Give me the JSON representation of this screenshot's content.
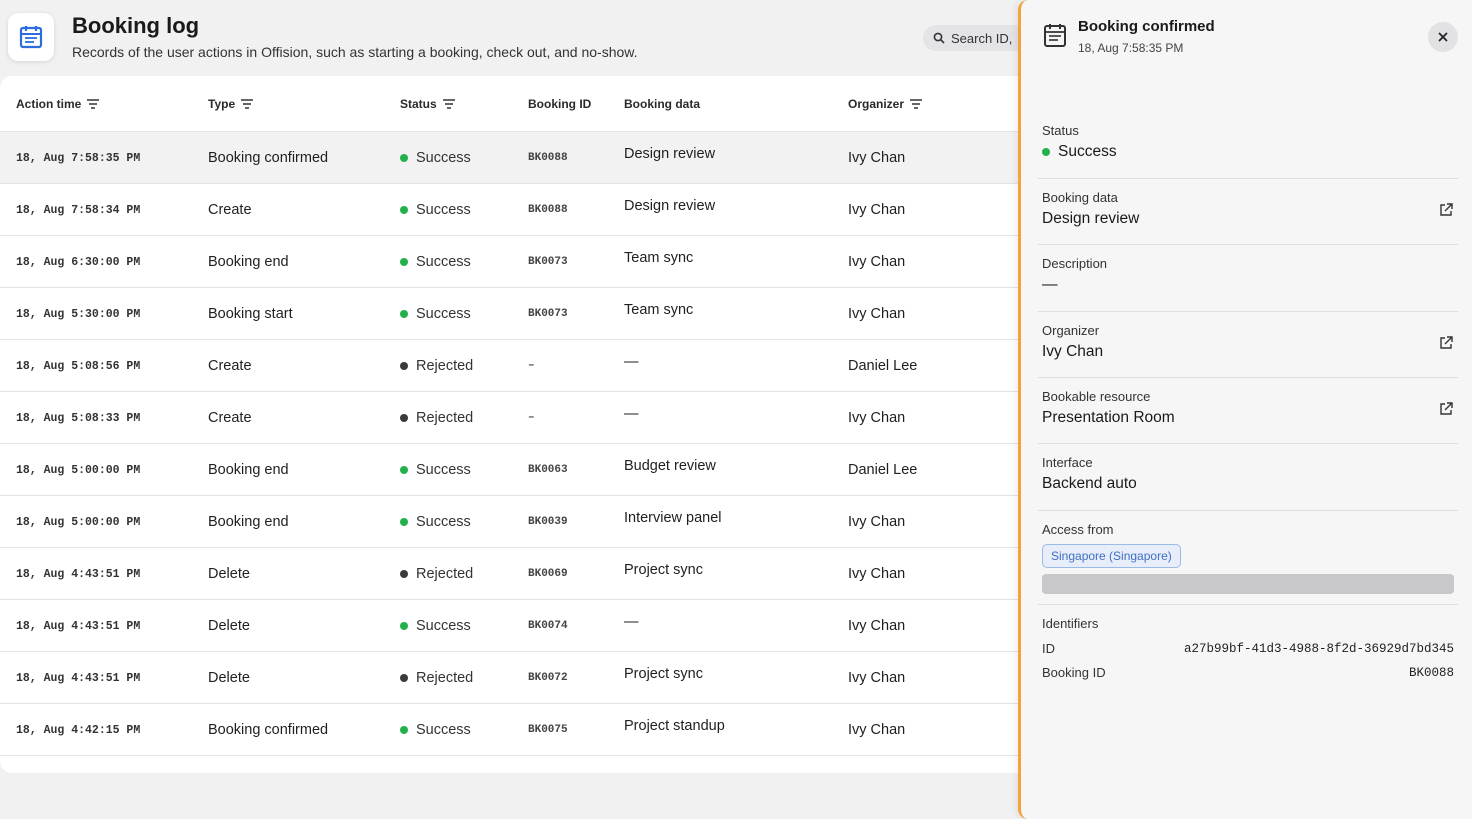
{
  "header": {
    "title": "Booking log",
    "subtitle": "Records of the user actions in Offision, such as starting a booking, check out, and no-show.",
    "search_placeholder": "Search ID,"
  },
  "table": {
    "columns": {
      "action_time": "Action time",
      "type": "Type",
      "status": "Status",
      "booking_id": "Booking ID",
      "booking_data": "Booking data",
      "organizer": "Organizer"
    },
    "rows": [
      {
        "time": "18, Aug 7:58:35 PM",
        "type": "Booking confirmed",
        "status": "Success",
        "booking_id": "BK0088",
        "booking_data": "Design review",
        "organizer": "Ivy Chan"
      },
      {
        "time": "18, Aug 7:58:34 PM",
        "type": "Create",
        "status": "Success",
        "booking_id": "BK0088",
        "booking_data": "Design review",
        "organizer": "Ivy Chan"
      },
      {
        "time": "18, Aug 6:30:00 PM",
        "type": "Booking end",
        "status": "Success",
        "booking_id": "BK0073",
        "booking_data": "Team sync",
        "organizer": "Ivy Chan"
      },
      {
        "time": "18, Aug 5:30:00 PM",
        "type": "Booking start",
        "status": "Success",
        "booking_id": "BK0073",
        "booking_data": "Team sync",
        "organizer": "Ivy Chan"
      },
      {
        "time": "18, Aug 5:08:56 PM",
        "type": "Create",
        "status": "Rejected",
        "booking_id": "–",
        "booking_data": "—",
        "organizer": "Daniel Lee"
      },
      {
        "time": "18, Aug 5:08:33 PM",
        "type": "Create",
        "status": "Rejected",
        "booking_id": "–",
        "booking_data": "—",
        "organizer": "Ivy Chan"
      },
      {
        "time": "18, Aug 5:00:00 PM",
        "type": "Booking end",
        "status": "Success",
        "booking_id": "BK0063",
        "booking_data": "Budget review",
        "organizer": "Daniel Lee"
      },
      {
        "time": "18, Aug 5:00:00 PM",
        "type": "Booking end",
        "status": "Success",
        "booking_id": "BK0039",
        "booking_data": "Interview panel",
        "organizer": "Ivy Chan"
      },
      {
        "time": "18, Aug 4:43:51 PM",
        "type": "Delete",
        "status": "Rejected",
        "booking_id": "BK0069",
        "booking_data": "Project sync",
        "organizer": "Ivy Chan"
      },
      {
        "time": "18, Aug 4:43:51 PM",
        "type": "Delete",
        "status": "Success",
        "booking_id": "BK0074",
        "booking_data": "—",
        "organizer": "Ivy Chan"
      },
      {
        "time": "18, Aug 4:43:51 PM",
        "type": "Delete",
        "status": "Rejected",
        "booking_id": "BK0072",
        "booking_data": "Project sync",
        "organizer": "Ivy Chan"
      },
      {
        "time": "18, Aug 4:42:15 PM",
        "type": "Booking confirmed",
        "status": "Success",
        "booking_id": "BK0075",
        "booking_data": "Project standup",
        "organizer": "Ivy Chan"
      }
    ]
  },
  "panel": {
    "title": "Booking confirmed",
    "timestamp": "18, Aug 7:58:35 PM",
    "status_label": "Status",
    "status_value": "Success",
    "booking_data_label": "Booking data",
    "booking_data_value": "Design review",
    "description_label": "Description",
    "description_value": "—",
    "organizer_label": "Organizer",
    "organizer_value": "Ivy Chan",
    "resource_label": "Bookable resource",
    "resource_value": "Presentation Room",
    "interface_label": "Interface",
    "interface_value": "Backend auto",
    "access_label": "Access from",
    "access_value": "Singapore (Singapore)",
    "identifiers_label": "Identifiers",
    "id_label": "ID",
    "id_value": "a27b99bf-41d3-4988-8f2d-36929d7bd345",
    "booking_id_label": "Booking ID",
    "booking_id_value": "BK0088"
  },
  "colors": {
    "success": "#22b14c",
    "rejected": "#3a3a3a",
    "accent": "#f2a33b",
    "tag_blue": "#3f6fc4"
  }
}
